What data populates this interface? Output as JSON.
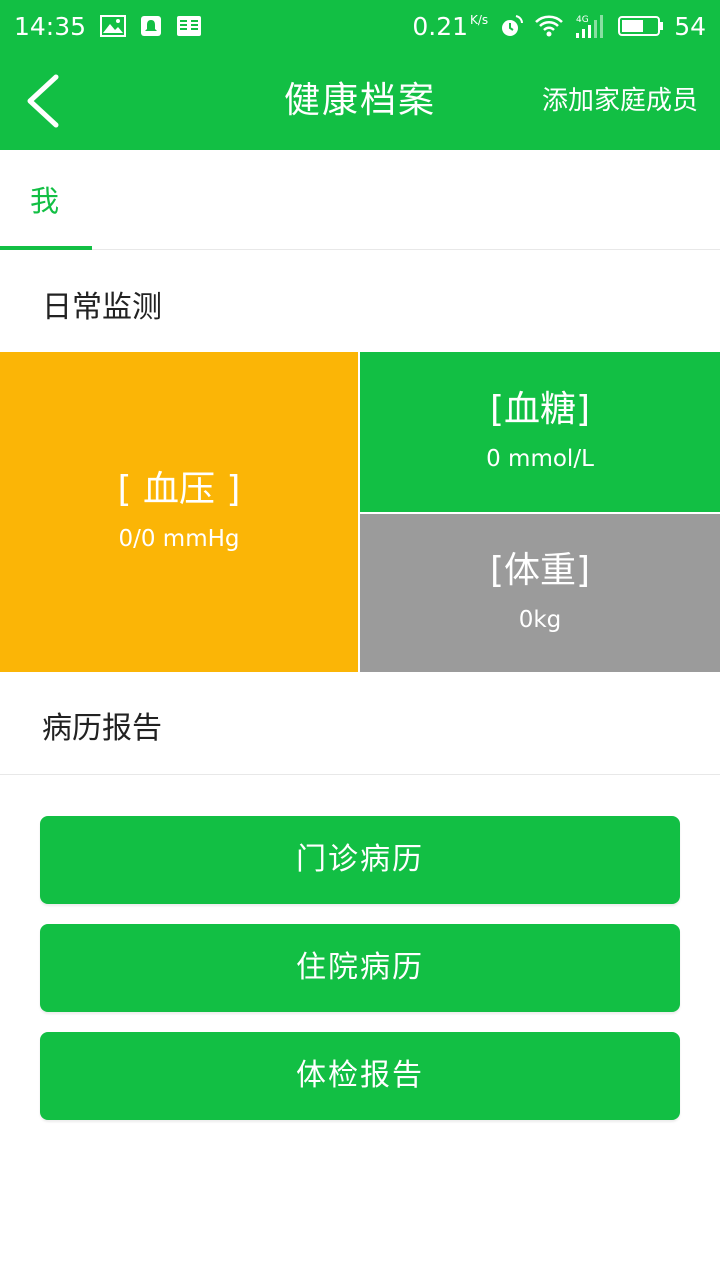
{
  "status_bar": {
    "time": "14:35",
    "net_speed": "0.21",
    "net_speed_unit": "K/s",
    "battery": "54",
    "icons": [
      "image-icon",
      "notification-icon",
      "reader-icon",
      "alarm-icon",
      "wifi-icon",
      "signal-4g-icon",
      "battery-icon"
    ]
  },
  "app_bar": {
    "back_icon": "chevron-left-icon",
    "title": "健康档案",
    "action": "添加家庭成员"
  },
  "tabs": [
    {
      "label": "我",
      "active": true
    }
  ],
  "daily_monitoring": {
    "title": "日常监测",
    "tiles": [
      {
        "name": "[ 血压 ]",
        "value": "0/0 mmHg",
        "color": "#fbb506"
      },
      {
        "name": "[血糖]",
        "value": "0 mmol/L",
        "color": "#12bf44"
      },
      {
        "name": "[体重]",
        "value": "0kg",
        "color": "#9b9b9b"
      }
    ]
  },
  "medical_records": {
    "title": "病历报告",
    "buttons": [
      {
        "label": "门诊病历"
      },
      {
        "label": "住院病历"
      },
      {
        "label": "体检报告"
      }
    ]
  },
  "colors": {
    "primary": "#12bf44",
    "accent_orange": "#fbb506",
    "neutral_gray": "#9b9b9b"
  }
}
